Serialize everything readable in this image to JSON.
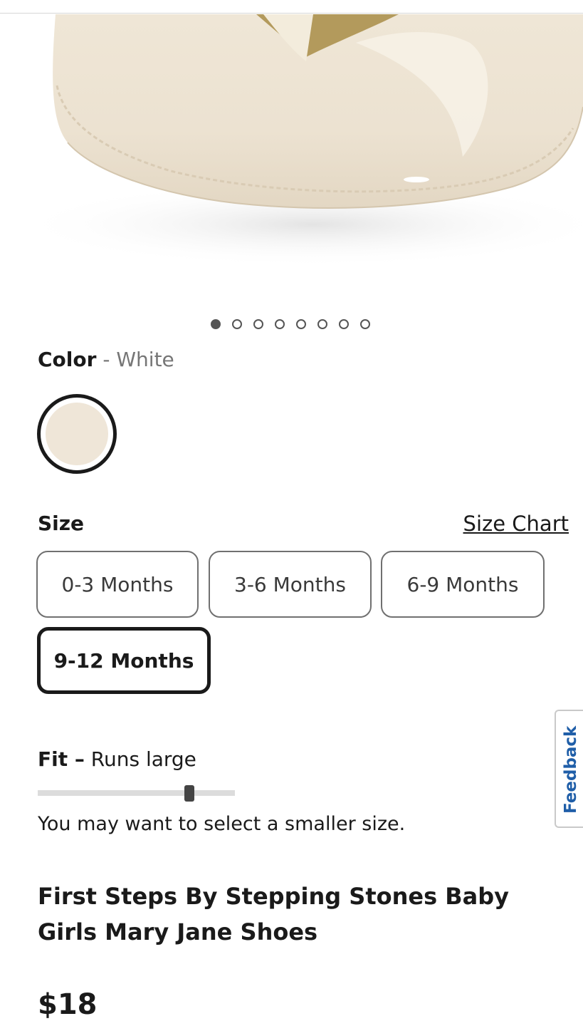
{
  "carousel": {
    "slide_count": 8,
    "active_index": 0
  },
  "color": {
    "heading": "Color",
    "separator": "-",
    "selected_name": "White",
    "swatch_hex": "#efe6d8"
  },
  "size": {
    "heading": "Size",
    "chart_link": "Size Chart",
    "options": [
      {
        "label": "0-3 Months",
        "selected": false
      },
      {
        "label": "3-6 Months",
        "selected": false
      },
      {
        "label": "6-9 Months",
        "selected": false
      },
      {
        "label": "9-12 Months",
        "selected": true
      }
    ]
  },
  "fit": {
    "heading": "Fit –",
    "value": "Runs large",
    "level": 0.77,
    "note": "You may want to select a smaller size."
  },
  "product": {
    "title": "First Steps By Stepping Stones Baby Girls Mary Jane Shoes",
    "price": "$18"
  },
  "feedback": {
    "label": "Feedback"
  },
  "colors": {
    "text": "#1a1a1a",
    "muted": "#767676",
    "feedback_blue": "#1f5ea8"
  }
}
